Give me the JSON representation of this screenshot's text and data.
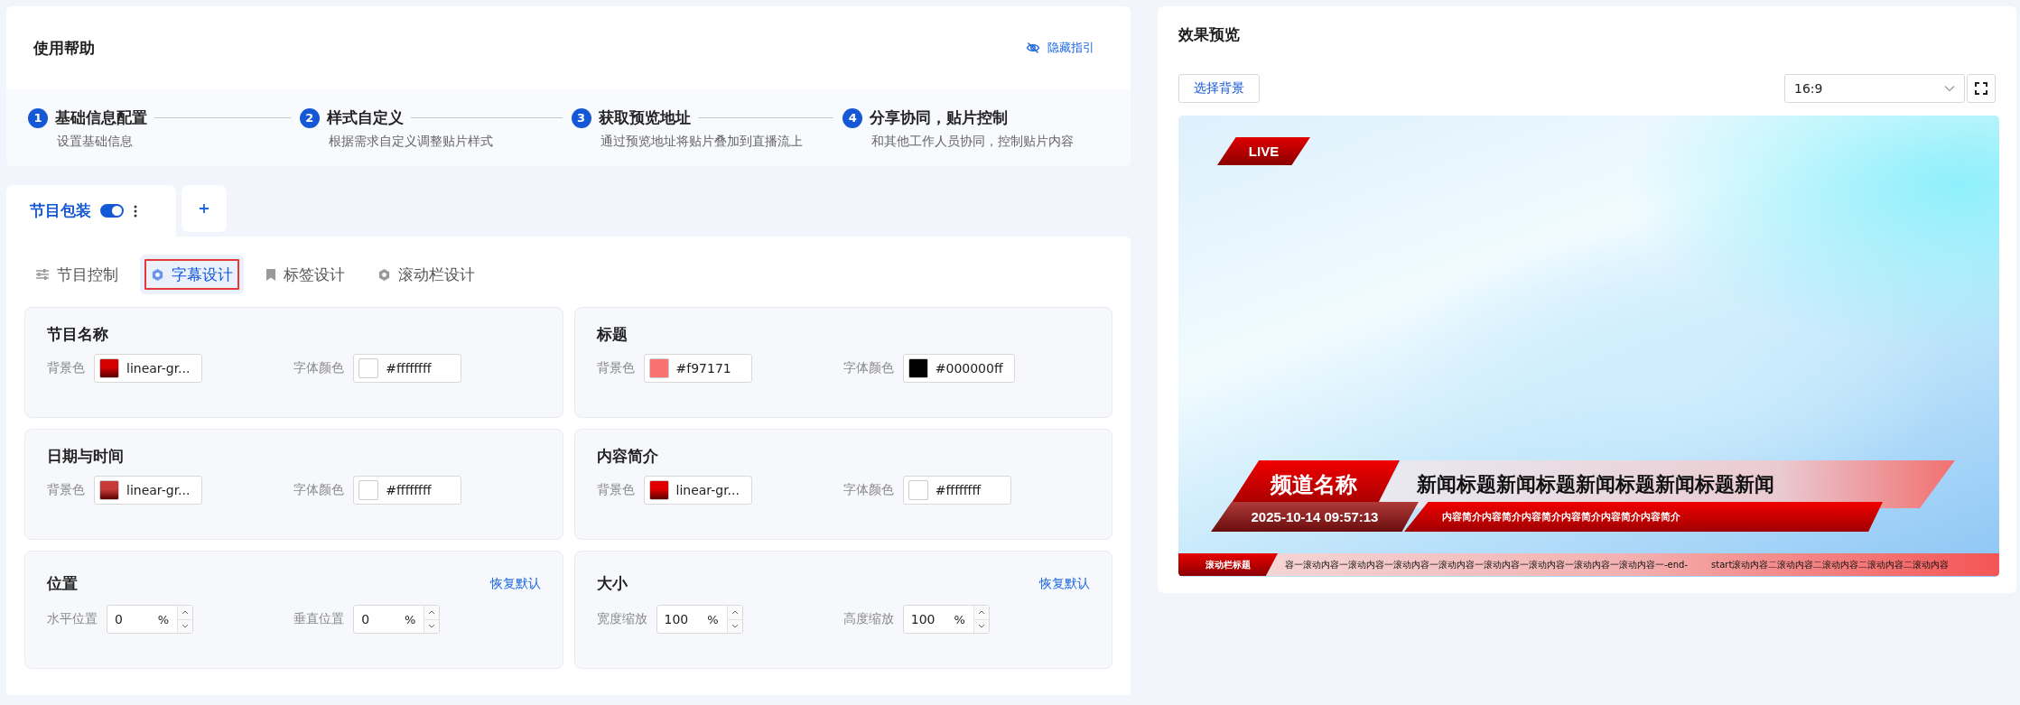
{
  "help": {
    "title": "使用帮助",
    "hide_link": "隐藏指引",
    "steps": [
      {
        "number": "1",
        "title": "基础信息配置",
        "description": "设置基础信息"
      },
      {
        "number": "2",
        "title": "样式自定义",
        "description": "根据需求自定义调整贴片样式"
      },
      {
        "number": "3",
        "title": "获取预览地址",
        "description": "通过预览地址将贴片叠加到直播流上"
      },
      {
        "number": "4",
        "title": "分享协同，贴片控制",
        "description": "和其他工作人员协同，控制贴片内容"
      }
    ]
  },
  "tabs": [
    {
      "label": "节目包装",
      "selected": true,
      "enabled": true
    }
  ],
  "sub_tabs": [
    {
      "label": "节目控制",
      "selected": false
    },
    {
      "label": "字幕设计",
      "selected": true
    },
    {
      "label": "标签设计",
      "selected": false
    },
    {
      "label": "滚动栏设计",
      "selected": false
    }
  ],
  "cards": [
    {
      "kind": "colors",
      "title": "节目名称",
      "fields": [
        {
          "label": "背景色",
          "value": "linear-gr...",
          "color": "#d40000",
          "gradient": true
        },
        {
          "label": "字体颜色",
          "value": "#ffffffff",
          "color": "#ffffff",
          "gradient": false
        }
      ]
    },
    {
      "kind": "colors",
      "title": "标题",
      "fields": [
        {
          "label": "背景色",
          "value": "#f97171",
          "color": "#f97171",
          "gradient": false
        },
        {
          "label": "字体颜色",
          "value": "#000000ff",
          "color": "#000000",
          "gradient": false
        }
      ]
    },
    {
      "kind": "colors",
      "title": "日期与时间",
      "fields": [
        {
          "label": "背景色",
          "value": "linear-gr...",
          "color": "#c83a3a",
          "gradient": true
        },
        {
          "label": "字体颜色",
          "value": "#ffffffff",
          "color": "#ffffff",
          "gradient": false
        }
      ]
    },
    {
      "kind": "colors",
      "title": "内容简介",
      "fields": [
        {
          "label": "背景色",
          "value": "linear-gr...",
          "color": "#e00000",
          "gradient": true
        },
        {
          "label": "字体颜色",
          "value": "#ffffffff",
          "color": "#ffffff",
          "gradient": false
        }
      ]
    },
    {
      "kind": "numbers",
      "title": "位置",
      "reset_link": "恢复默认",
      "fields": [
        {
          "label": "水平位置",
          "value": "0",
          "unit": "%"
        },
        {
          "label": "垂直位置",
          "value": "0",
          "unit": "%"
        }
      ]
    },
    {
      "kind": "numbers",
      "title": "大小",
      "reset_link": "恢复默认",
      "fields": [
        {
          "label": "宽度缩放",
          "value": "100",
          "unit": "%"
        },
        {
          "label": "高度缩放",
          "value": "100",
          "unit": "%"
        }
      ]
    }
  ],
  "preview": {
    "title": "效果预览",
    "background_button": "选择背景",
    "ratio_select": {
      "value": "16:9"
    },
    "overlay": {
      "live_badge": "LIVE",
      "channel_name": "频道名称",
      "headline": "新闻标题新闻标题新闻标题新闻标题新闻",
      "datetime": "2025-10-14 09:57:13",
      "summary": "内容简介内容简介内容简介内容简介内容简介内容简介",
      "ticker_title": "滚动栏标题",
      "ticker_items": [
        "容一滚动内容一滚动内容一滚动内容一滚动内容一滚动内容一滚动内容一滚动内容一滚动内容一-end-",
        "start滚动内容二滚动内容二滚动内容二滚动内容二滚动内容"
      ]
    }
  }
}
